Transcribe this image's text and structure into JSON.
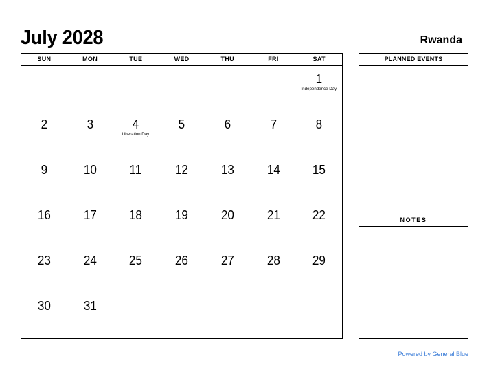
{
  "header": {
    "month_title": "July 2028",
    "country": "Rwanda"
  },
  "calendar": {
    "weekdays": [
      "SUN",
      "MON",
      "TUE",
      "WED",
      "THU",
      "FRI",
      "SAT"
    ],
    "weeks": [
      [
        {
          "day": "",
          "event": ""
        },
        {
          "day": "",
          "event": ""
        },
        {
          "day": "",
          "event": ""
        },
        {
          "day": "",
          "event": ""
        },
        {
          "day": "",
          "event": ""
        },
        {
          "day": "",
          "event": ""
        },
        {
          "day": "1",
          "event": "Independence Day"
        }
      ],
      [
        {
          "day": "2",
          "event": ""
        },
        {
          "day": "3",
          "event": ""
        },
        {
          "day": "4",
          "event": "Liberation Day"
        },
        {
          "day": "5",
          "event": ""
        },
        {
          "day": "6",
          "event": ""
        },
        {
          "day": "7",
          "event": ""
        },
        {
          "day": "8",
          "event": ""
        }
      ],
      [
        {
          "day": "9",
          "event": ""
        },
        {
          "day": "10",
          "event": ""
        },
        {
          "day": "11",
          "event": ""
        },
        {
          "day": "12",
          "event": ""
        },
        {
          "day": "13",
          "event": ""
        },
        {
          "day": "14",
          "event": ""
        },
        {
          "day": "15",
          "event": ""
        }
      ],
      [
        {
          "day": "16",
          "event": ""
        },
        {
          "day": "17",
          "event": ""
        },
        {
          "day": "18",
          "event": ""
        },
        {
          "day": "19",
          "event": ""
        },
        {
          "day": "20",
          "event": ""
        },
        {
          "day": "21",
          "event": ""
        },
        {
          "day": "22",
          "event": ""
        }
      ],
      [
        {
          "day": "23",
          "event": ""
        },
        {
          "day": "24",
          "event": ""
        },
        {
          "day": "25",
          "event": ""
        },
        {
          "day": "26",
          "event": ""
        },
        {
          "day": "27",
          "event": ""
        },
        {
          "day": "28",
          "event": ""
        },
        {
          "day": "29",
          "event": ""
        }
      ],
      [
        {
          "day": "30",
          "event": ""
        },
        {
          "day": "31",
          "event": ""
        },
        {
          "day": "",
          "event": ""
        },
        {
          "day": "",
          "event": ""
        },
        {
          "day": "",
          "event": ""
        },
        {
          "day": "",
          "event": ""
        },
        {
          "day": "",
          "event": ""
        }
      ]
    ]
  },
  "side_boxes": {
    "planned_events_title": "PLANNED EVENTS",
    "notes_title": "NOTES"
  },
  "footer": {
    "link_text": "Powered by General Blue",
    "link_color": "#3b7dd8"
  }
}
